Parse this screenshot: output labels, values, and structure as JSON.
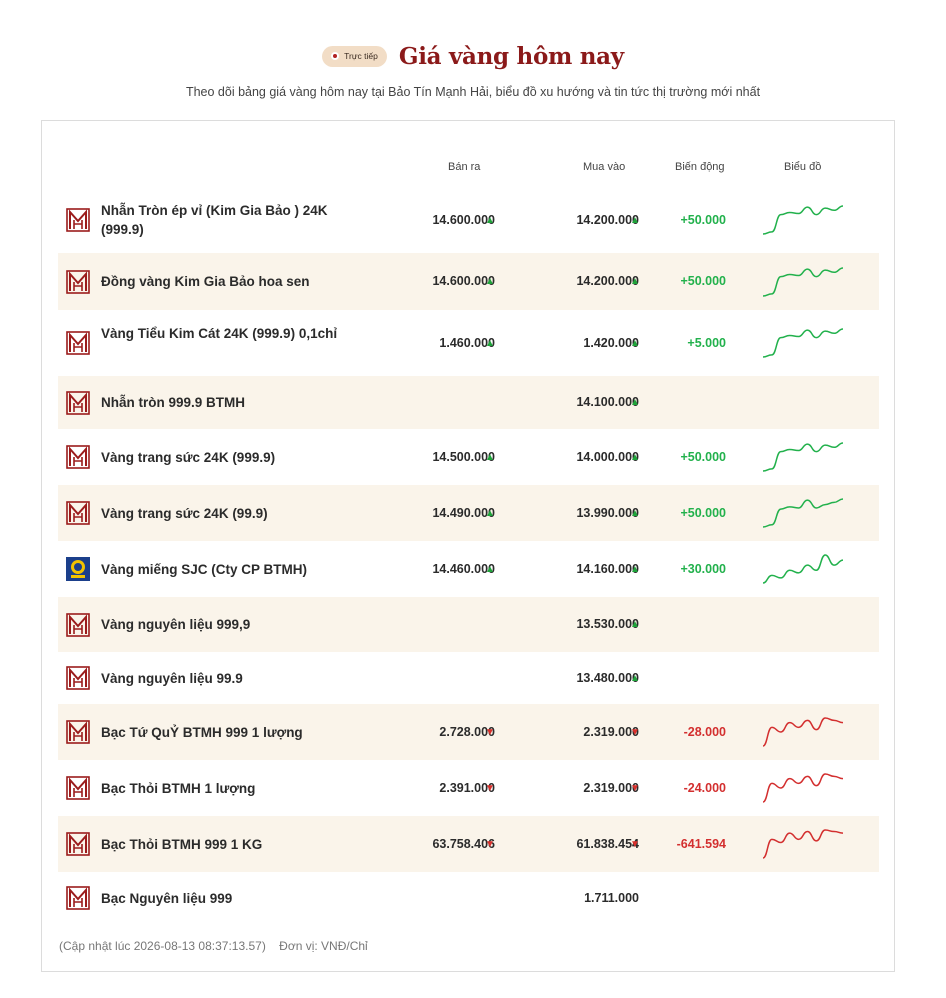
{
  "header": {
    "badge": "Trực tiếp",
    "title": "Giá vàng hôm nay",
    "subtitle": "Theo dõi bảng giá vàng hôm nay tại Bảo Tín Mạnh Hải, biểu đồ xu hướng và tin tức thị trường mới nhất"
  },
  "table": {
    "columns": {
      "sell": "Bán ra",
      "buy": "Mua vào",
      "change": "Biến động",
      "chart": "Biểu đồ"
    },
    "rows": [
      {
        "logo": "btmh",
        "name": "Nhẫn Tròn ép vỉ (Kim Gia Bảo ) 24K (999.9)",
        "sell": "14.600.000",
        "buy": "14.200.000",
        "change": "+50.000",
        "trend": "up",
        "spark": [
          14.0,
          14.02,
          14.18,
          14.2,
          14.19,
          14.25,
          14.18,
          14.24,
          14.22,
          14.26
        ]
      },
      {
        "logo": "btmh",
        "name": "Đồng vàng Kim Gia Bảo hoa sen",
        "sell": "14.600.000",
        "buy": "14.200.000",
        "change": "+50.000",
        "trend": "up",
        "spark": [
          14.0,
          14.02,
          14.18,
          14.2,
          14.19,
          14.25,
          14.18,
          14.24,
          14.22,
          14.26
        ]
      },
      {
        "logo": "btmh",
        "name": "Vàng Tiểu Kim Cát 24K (999.9) 0,1chỉ",
        "sell": "1.460.000",
        "buy": "1.420.000",
        "change": "+5.000",
        "trend": "up",
        "spark": [
          1.4,
          1.402,
          1.418,
          1.42,
          1.419,
          1.425,
          1.418,
          1.424,
          1.422,
          1.426
        ]
      },
      {
        "logo": "btmh",
        "name": "Nhẫn tròn 999.9 BTMH",
        "sell": "",
        "buy": "14.100.000",
        "change": "",
        "trend": "up",
        "spark": []
      },
      {
        "logo": "btmh",
        "name": "Vàng trang sức 24K (999.9)",
        "sell": "14.500.000",
        "buy": "14.000.000",
        "change": "+50.000",
        "trend": "up",
        "spark": [
          13.8,
          13.82,
          13.98,
          14.0,
          13.99,
          14.05,
          13.98,
          14.04,
          14.02,
          14.06
        ]
      },
      {
        "logo": "btmh",
        "name": "Vàng trang sức 24K (99.9)",
        "sell": "14.490.000",
        "buy": "13.990.000",
        "change": "+50.000",
        "trend": "up",
        "spark": [
          13.8,
          13.82,
          13.96,
          13.98,
          13.97,
          14.04,
          13.97,
          14.0,
          14.02,
          14.05
        ]
      },
      {
        "logo": "sjc",
        "name": "Vàng miếng SJC (Cty CP BTMH)",
        "sell": "14.460.000",
        "buy": "14.160.000",
        "change": "+30.000",
        "trend": "up",
        "spark": [
          14.05,
          14.08,
          14.07,
          14.1,
          14.09,
          14.12,
          14.1,
          14.16,
          14.12,
          14.14
        ]
      },
      {
        "logo": "btmh",
        "name": "Vàng nguyên liệu 999,9",
        "sell": "",
        "buy": "13.530.000",
        "change": "",
        "trend": "up",
        "spark": []
      },
      {
        "logo": "btmh",
        "name": "Vàng nguyên liệu 99.9",
        "sell": "",
        "buy": "13.480.000",
        "change": "",
        "trend": "up",
        "spark": []
      },
      {
        "logo": "btmh",
        "name": "Bạc Tứ QuỶ BTMH 999 1 lượng",
        "sell": "2.728.000",
        "buy": "2.319.000",
        "change": "-28.000",
        "trend": "down",
        "spark": [
          2.2,
          2.28,
          2.26,
          2.3,
          2.28,
          2.31,
          2.27,
          2.32,
          2.31,
          2.3
        ]
      },
      {
        "logo": "btmh",
        "name": "Bạc Thỏi BTMH 1 lượng",
        "sell": "2.391.000",
        "buy": "2.319.000",
        "change": "-24.000",
        "trend": "down",
        "spark": [
          2.2,
          2.28,
          2.26,
          2.3,
          2.28,
          2.31,
          2.27,
          2.32,
          2.31,
          2.3
        ]
      },
      {
        "logo": "btmh",
        "name": "Bạc Thỏi BTMH 999 1 KG",
        "sell": "63.758.406",
        "buy": "61.838.454",
        "change": "-641.594",
        "trend": "down",
        "spark": [
          61.0,
          61.6,
          61.5,
          61.8,
          61.6,
          61.85,
          61.55,
          61.9,
          61.85,
          61.8
        ]
      },
      {
        "logo": "btmh",
        "name": "Bạc Nguyên liệu 999",
        "sell": "",
        "buy": "1.711.000",
        "change": "",
        "trend": "none",
        "spark": []
      }
    ]
  },
  "footer": {
    "updated": "(Cập nhật lúc 2026-08-13 08:37:13.57)",
    "unit": "Đơn vị: VNĐ/Chỉ"
  },
  "colors": {
    "brand": "#8b1a1a",
    "up": "#22b14c",
    "down": "#d32f2f",
    "alt_row": "#faf4ea"
  }
}
